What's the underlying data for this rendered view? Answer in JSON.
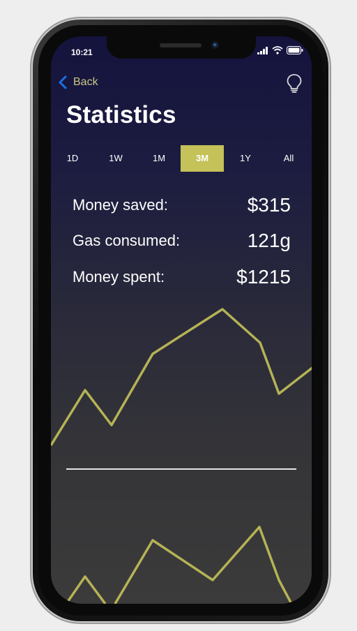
{
  "status_bar": {
    "time": "10:21"
  },
  "nav": {
    "back_label": "Back"
  },
  "page": {
    "title": "Statistics"
  },
  "periods": [
    {
      "label": "1D",
      "active": false
    },
    {
      "label": "1W",
      "active": false
    },
    {
      "label": "1M",
      "active": false
    },
    {
      "label": "3M",
      "active": true
    },
    {
      "label": "1Y",
      "active": false
    },
    {
      "label": "All",
      "active": false
    }
  ],
  "stats": [
    {
      "label": "Money saved:",
      "value": "$315"
    },
    {
      "label": "Gas consumed:",
      "value": "121g"
    },
    {
      "label": "Money spent:",
      "value": "$1215"
    }
  ],
  "colors": {
    "accent": "#c4c258",
    "line": "#b5b355",
    "link": "#c9c785",
    "back_icon": "#1e6fe0"
  },
  "icons": {
    "back": "chevron-left-icon",
    "tip": "lightbulb-icon",
    "signal": "signal-icon",
    "wifi": "wifi-icon",
    "battery": "battery-icon"
  }
}
